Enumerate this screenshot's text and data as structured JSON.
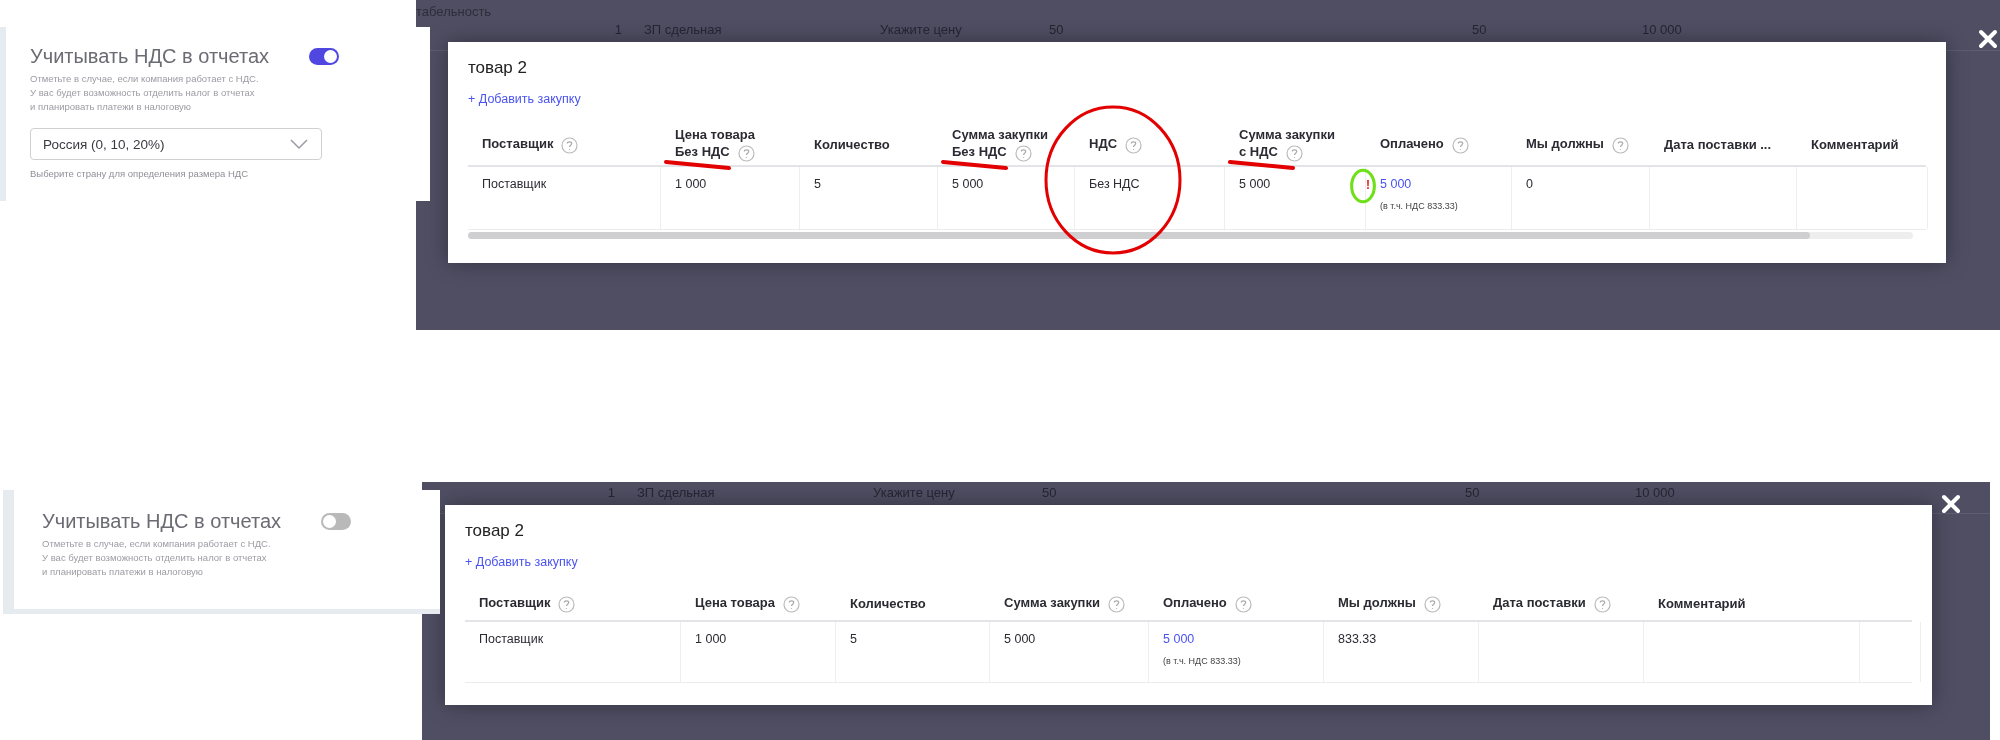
{
  "screens": [
    {
      "settings": {
        "title": "Учитывать НДС в отчетах",
        "on": true,
        "description": [
          "Отметьте в случае, если компания работает с НДС.",
          "У вас будет возможность отделить налог в отчетах",
          "и планировать платежи в налоговую"
        ],
        "country_select": {
          "value": "Россия (0, 10, 20%)"
        },
        "hint": "Выберите страну для определения размера НДС"
      },
      "background": {
        "fragment": "табельность",
        "row": [
          "1",
          "ЗП сдельная",
          "Укажите цену",
          "50",
          "50",
          "10 000"
        ]
      },
      "modal": {
        "title": "товар 2",
        "add_link": "+ Добавить закупку",
        "scrollbar": true,
        "columns": [
          {
            "lines": [
              "Поставщик"
            ],
            "help": true
          },
          {
            "lines": [
              "Цена товара",
              "Без НДС"
            ],
            "help": true,
            "underlined": true
          },
          {
            "lines": [
              "Количество"
            ],
            "help": false
          },
          {
            "lines": [
              "Сумма закупки",
              "Без НДС"
            ],
            "help": true,
            "underlined": true
          },
          {
            "lines": [
              "НДС"
            ],
            "help": true,
            "circled": true
          },
          {
            "lines": [
              "Сумма закупки",
              "с НДС"
            ],
            "help": true,
            "underlined": true
          },
          {
            "lines": [
              "Оплачено"
            ],
            "help": true
          },
          {
            "lines": [
              "Мы должны"
            ],
            "help": true
          },
          {
            "lines": [
              "Дата поставки ..."
            ],
            "help": false
          },
          {
            "lines": [
              "Комментарий"
            ],
            "help": false
          }
        ],
        "rows": [
          {
            "cells": [
              {
                "kind": "text",
                "text": "Поставщик"
              },
              {
                "kind": "text",
                "text": "1 000"
              },
              {
                "kind": "text",
                "text": "5"
              },
              {
                "kind": "text",
                "text": "5 000"
              },
              {
                "kind": "text",
                "text": "Без НДС"
              },
              {
                "kind": "text",
                "text": "5 000"
              },
              {
                "kind": "link",
                "text": "5 000",
                "note": "(в т.ч. НДС 833.33)",
                "warning": "!",
                "ringed": true
              },
              {
                "kind": "text",
                "text": "0"
              },
              {
                "kind": "empty"
              },
              {
                "kind": "empty"
              }
            ]
          }
        ]
      }
    },
    {
      "settings": {
        "title": "Учитывать НДС в отчетах",
        "on": false,
        "description": [
          "Отметьте в случае, если компания работает с НДС.",
          "У вас будет возможность отделить налог в отчетах",
          "и планировать платежи в налоговую"
        ]
      },
      "background": {
        "row": [
          "1",
          "ЗП сдельная",
          "Укажите цену",
          "50",
          "50",
          "10 000"
        ]
      },
      "modal": {
        "title": "товар 2",
        "add_link": "+ Добавить закупку",
        "columns": [
          {
            "lines": [
              "Поставщик"
            ],
            "help": true
          },
          {
            "lines": [
              "Цена товара"
            ],
            "help": true
          },
          {
            "lines": [
              "Количество"
            ],
            "help": false
          },
          {
            "lines": [
              "Сумма закупки"
            ],
            "help": true
          },
          {
            "lines": [
              "Оплачено"
            ],
            "help": true
          },
          {
            "lines": [
              "Мы должны"
            ],
            "help": true
          },
          {
            "lines": [
              "Дата поставки"
            ],
            "help": true
          },
          {
            "lines": [
              "Комментарий"
            ],
            "help": false
          },
          {}
        ],
        "rows": [
          {
            "cells": [
              {
                "kind": "text",
                "text": "Поставщик"
              },
              {
                "kind": "text",
                "text": "1 000"
              },
              {
                "kind": "text",
                "text": "5"
              },
              {
                "kind": "text",
                "text": "5 000"
              },
              {
                "kind": "link",
                "text": "5 000",
                "note": "(в т.ч. НДС 833.33)"
              },
              {
                "kind": "text",
                "text": "833.33"
              },
              {
                "kind": "empty"
              },
              {
                "kind": "empty"
              },
              {
                "kind": "empty"
              }
            ]
          }
        ]
      }
    }
  ]
}
